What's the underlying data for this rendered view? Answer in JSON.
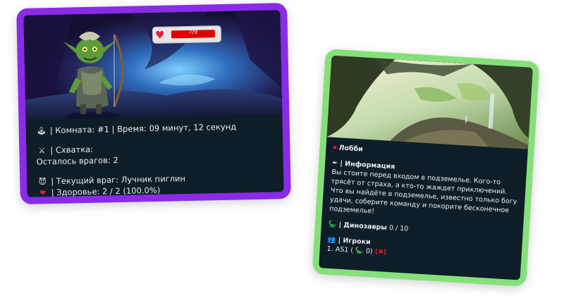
{
  "battle": {
    "hp_text": "7/9",
    "room_line": "| Комната: #1 | Время: 09 минут, 12 секунд",
    "fight_line": "| Схватка:",
    "enemies_left": "Осталось врагов: 2",
    "current_enemy": "| Текущий враг: Лучник пиглин",
    "health": "| Здоровье: 2 / 2 (100.0%)",
    "icons": [
      "joystick-icon",
      "crossed-swords-icon",
      "devil-icon",
      "heart-icon"
    ]
  },
  "lobby": {
    "title": "Лобби",
    "info_header": "| Информация",
    "description": "Вы стоите перед входом в подземелье. Кого-то трясёт от страха, а кто-то жаждет приключений. Что вы найдёте в подземелье, известно только богу удачи, соберите команду и покорите бесконечное подземелье!",
    "dinos_header": "| Динозавры",
    "dinos_count": "0 / 10",
    "players_header": "| Игроки",
    "player_entry_prefix": "1. AS1 (",
    "player_entry_count": "0)",
    "icons": [
      "record-icon",
      "quill-icon",
      "dinosaur-icon",
      "players-icon",
      "cross-mark-icon"
    ]
  },
  "colors": {
    "left_frame": "#8a2be8",
    "right_frame": "#86e07a",
    "panel_bg": "#0f1d28",
    "text": "#e8eef2",
    "hp_fill": "#e00000"
  }
}
